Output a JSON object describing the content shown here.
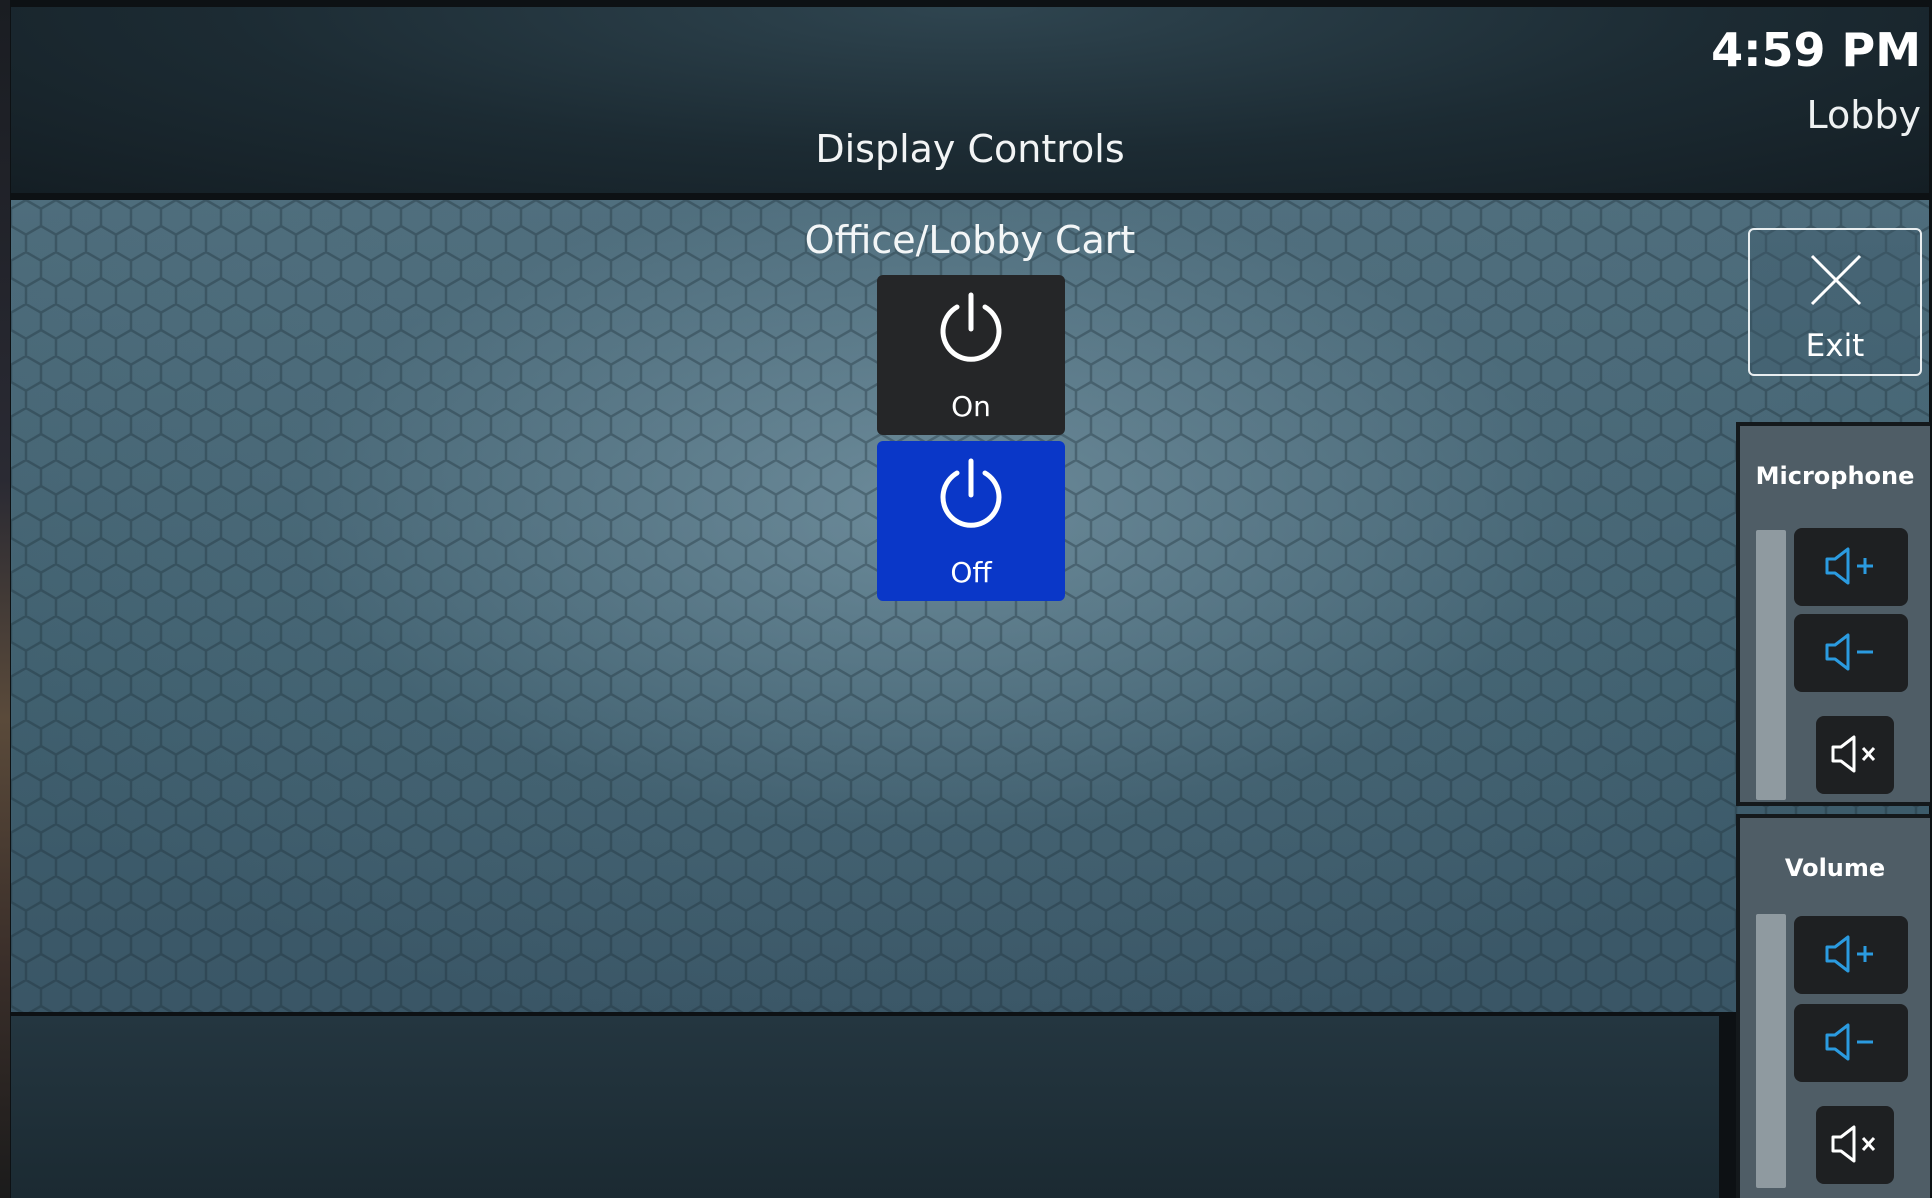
{
  "header": {
    "title": "Display Controls",
    "time": "4:59 PM",
    "room": "Lobby"
  },
  "main": {
    "cart_title": "Office/Lobby Cart",
    "power_on_label": "On",
    "power_off_label": "Off",
    "exit_label": "Exit"
  },
  "microphone": {
    "title": "Microphone"
  },
  "volume": {
    "title": "Volume"
  },
  "colors": {
    "active_blue": "#0a37c8",
    "button_dark": "#252628",
    "icon_blue": "#2b9be0"
  }
}
